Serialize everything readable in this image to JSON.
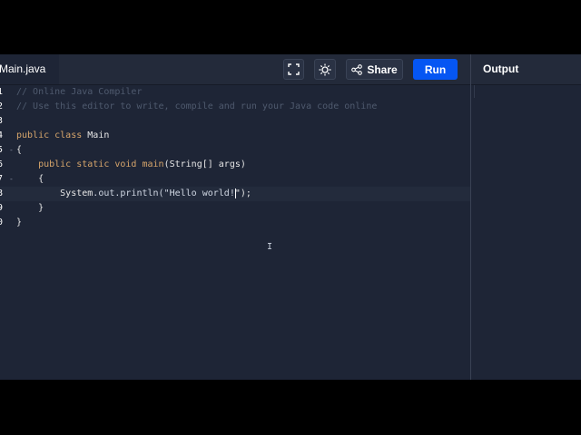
{
  "toolbar": {
    "file_tab": "Main.java",
    "share_label": "Share",
    "run_label": "Run",
    "output_label": "Output",
    "icons": [
      "fullscreen-icon",
      "theme-sun-icon",
      "share-icon"
    ],
    "run_color": "#0556f3"
  },
  "editor": {
    "lines": [
      {
        "num": "1",
        "fold": "",
        "parts": [
          {
            "t": "// Online Java Compiler",
            "c": "comment"
          }
        ]
      },
      {
        "num": "2",
        "fold": "",
        "parts": [
          {
            "t": "// Use this editor to write, compile and run your Java code online",
            "c": "comment"
          }
        ]
      },
      {
        "num": "3",
        "fold": "",
        "parts": []
      },
      {
        "num": "4",
        "fold": "",
        "parts": [
          {
            "t": "public class ",
            "c": "kw"
          },
          {
            "t": "Main",
            "c": "plain"
          }
        ]
      },
      {
        "num": "5",
        "fold": "-",
        "parts": [
          {
            "t": "{",
            "c": "plain"
          }
        ]
      },
      {
        "num": "6",
        "fold": "",
        "parts": [
          {
            "t": "    public static void ",
            "c": "kw"
          },
          {
            "t": "main",
            "c": "fn"
          },
          {
            "t": "(String[] args)",
            "c": "plain"
          }
        ]
      },
      {
        "num": "7",
        "fold": "-",
        "parts": [
          {
            "t": "    {",
            "c": "plain"
          }
        ]
      },
      {
        "num": "8",
        "fold": "",
        "parts": [
          {
            "t": "        System",
            "c": "plain"
          },
          {
            "t": ".out.println(",
            "c": "str"
          },
          {
            "t": "\"Hello world!",
            "c": "str"
          },
          {
            "t": "CARET",
            "c": "caret"
          },
          {
            "t": "\");",
            "c": "plain"
          }
        ]
      },
      {
        "num": "9",
        "fold": "",
        "parts": [
          {
            "t": "    }",
            "c": "plain"
          }
        ]
      },
      {
        "num": "0",
        "fold": "",
        "parts": [
          {
            "t": "}",
            "c": "plain"
          }
        ]
      }
    ],
    "active_line": 7
  }
}
